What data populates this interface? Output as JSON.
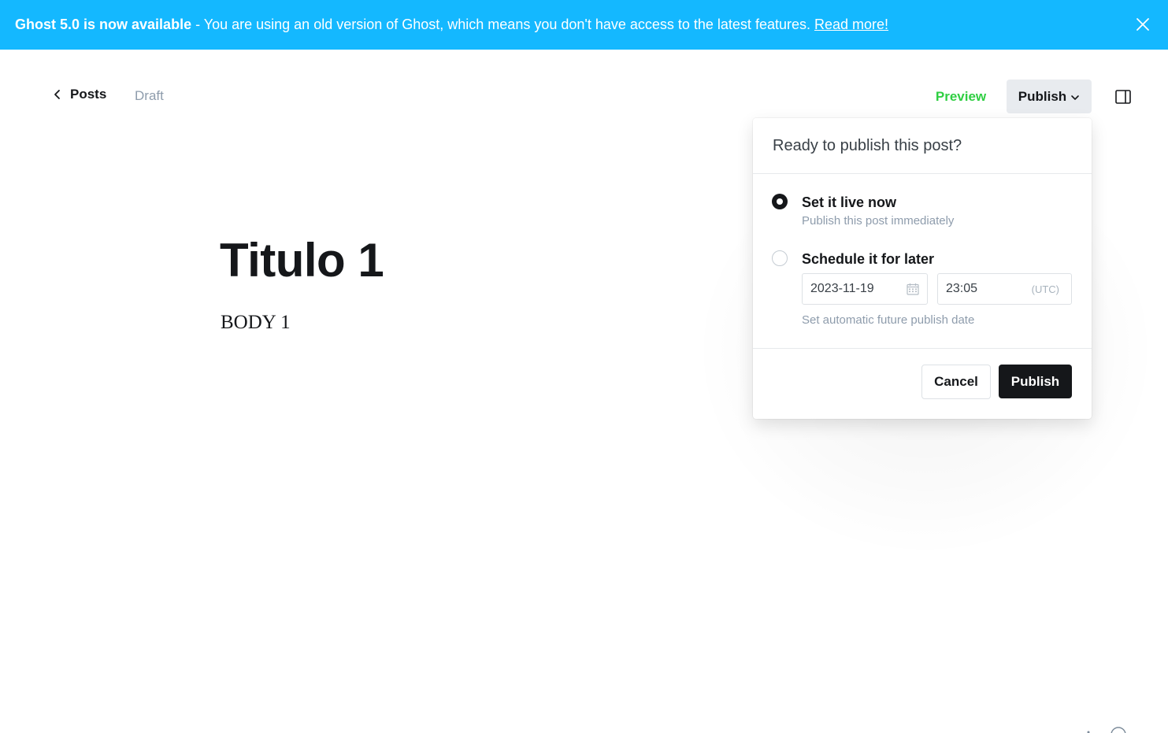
{
  "banner": {
    "headline": "Ghost 5.0 is now available",
    "message": "- You are using an old version of Ghost, which means you don't have access to the latest features.",
    "link": "Read more!",
    "color": "#14b8ff"
  },
  "topbar": {
    "back_label": "Posts",
    "status": "Draft",
    "preview_label": "Preview",
    "publish_label": "Publish"
  },
  "post": {
    "title": "Titulo 1",
    "body": "BODY 1"
  },
  "publish_menu": {
    "header": "Ready to publish this post?",
    "options": [
      {
        "title": "Set it live now",
        "subtitle": "Publish this post immediately",
        "selected": true
      },
      {
        "title": "Schedule it for later",
        "selected": false
      }
    ],
    "schedule": {
      "date": "2023-11-19",
      "time": "23:05",
      "timezone": "(UTC)",
      "help": "Set automatic future publish date"
    },
    "cancel_label": "Cancel",
    "publish_label": "Publish"
  },
  "colors": {
    "accent_green": "#30cf43",
    "dark": "#15171a"
  }
}
